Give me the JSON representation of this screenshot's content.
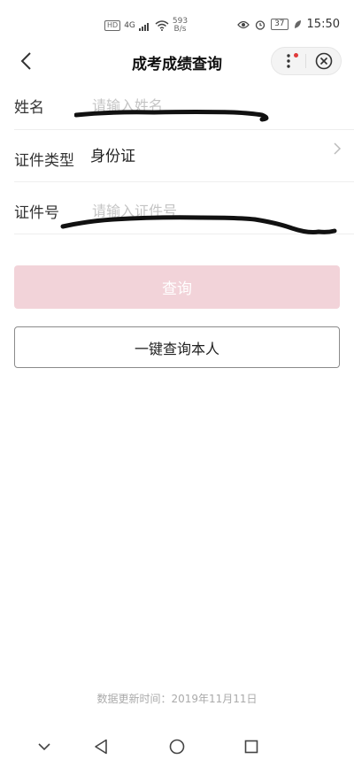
{
  "status_bar": {
    "hd": "HD",
    "network": "4G",
    "speed_value": "593",
    "speed_unit": "B/s",
    "battery": "37",
    "time": "15:50"
  },
  "nav": {
    "title": "成考成绩查询",
    "icons": [
      "back-chevron-icon",
      "more-dots-icon",
      "close-circle-icon"
    ]
  },
  "form": {
    "name_label": "姓名",
    "name_placeholder": "请输入姓名",
    "id_type_label": "证件类型",
    "id_type_value": "身份证",
    "id_number_label": "证件号",
    "id_number_placeholder": "请输入证件号"
  },
  "buttons": {
    "query": "查询",
    "query_self": "一键查询本人"
  },
  "footer": {
    "update_time": "数据更新时间：2019年11月11日"
  },
  "colors": {
    "query_button_bg": "#f2d3d9",
    "notification_dot": "#e03b3b"
  }
}
